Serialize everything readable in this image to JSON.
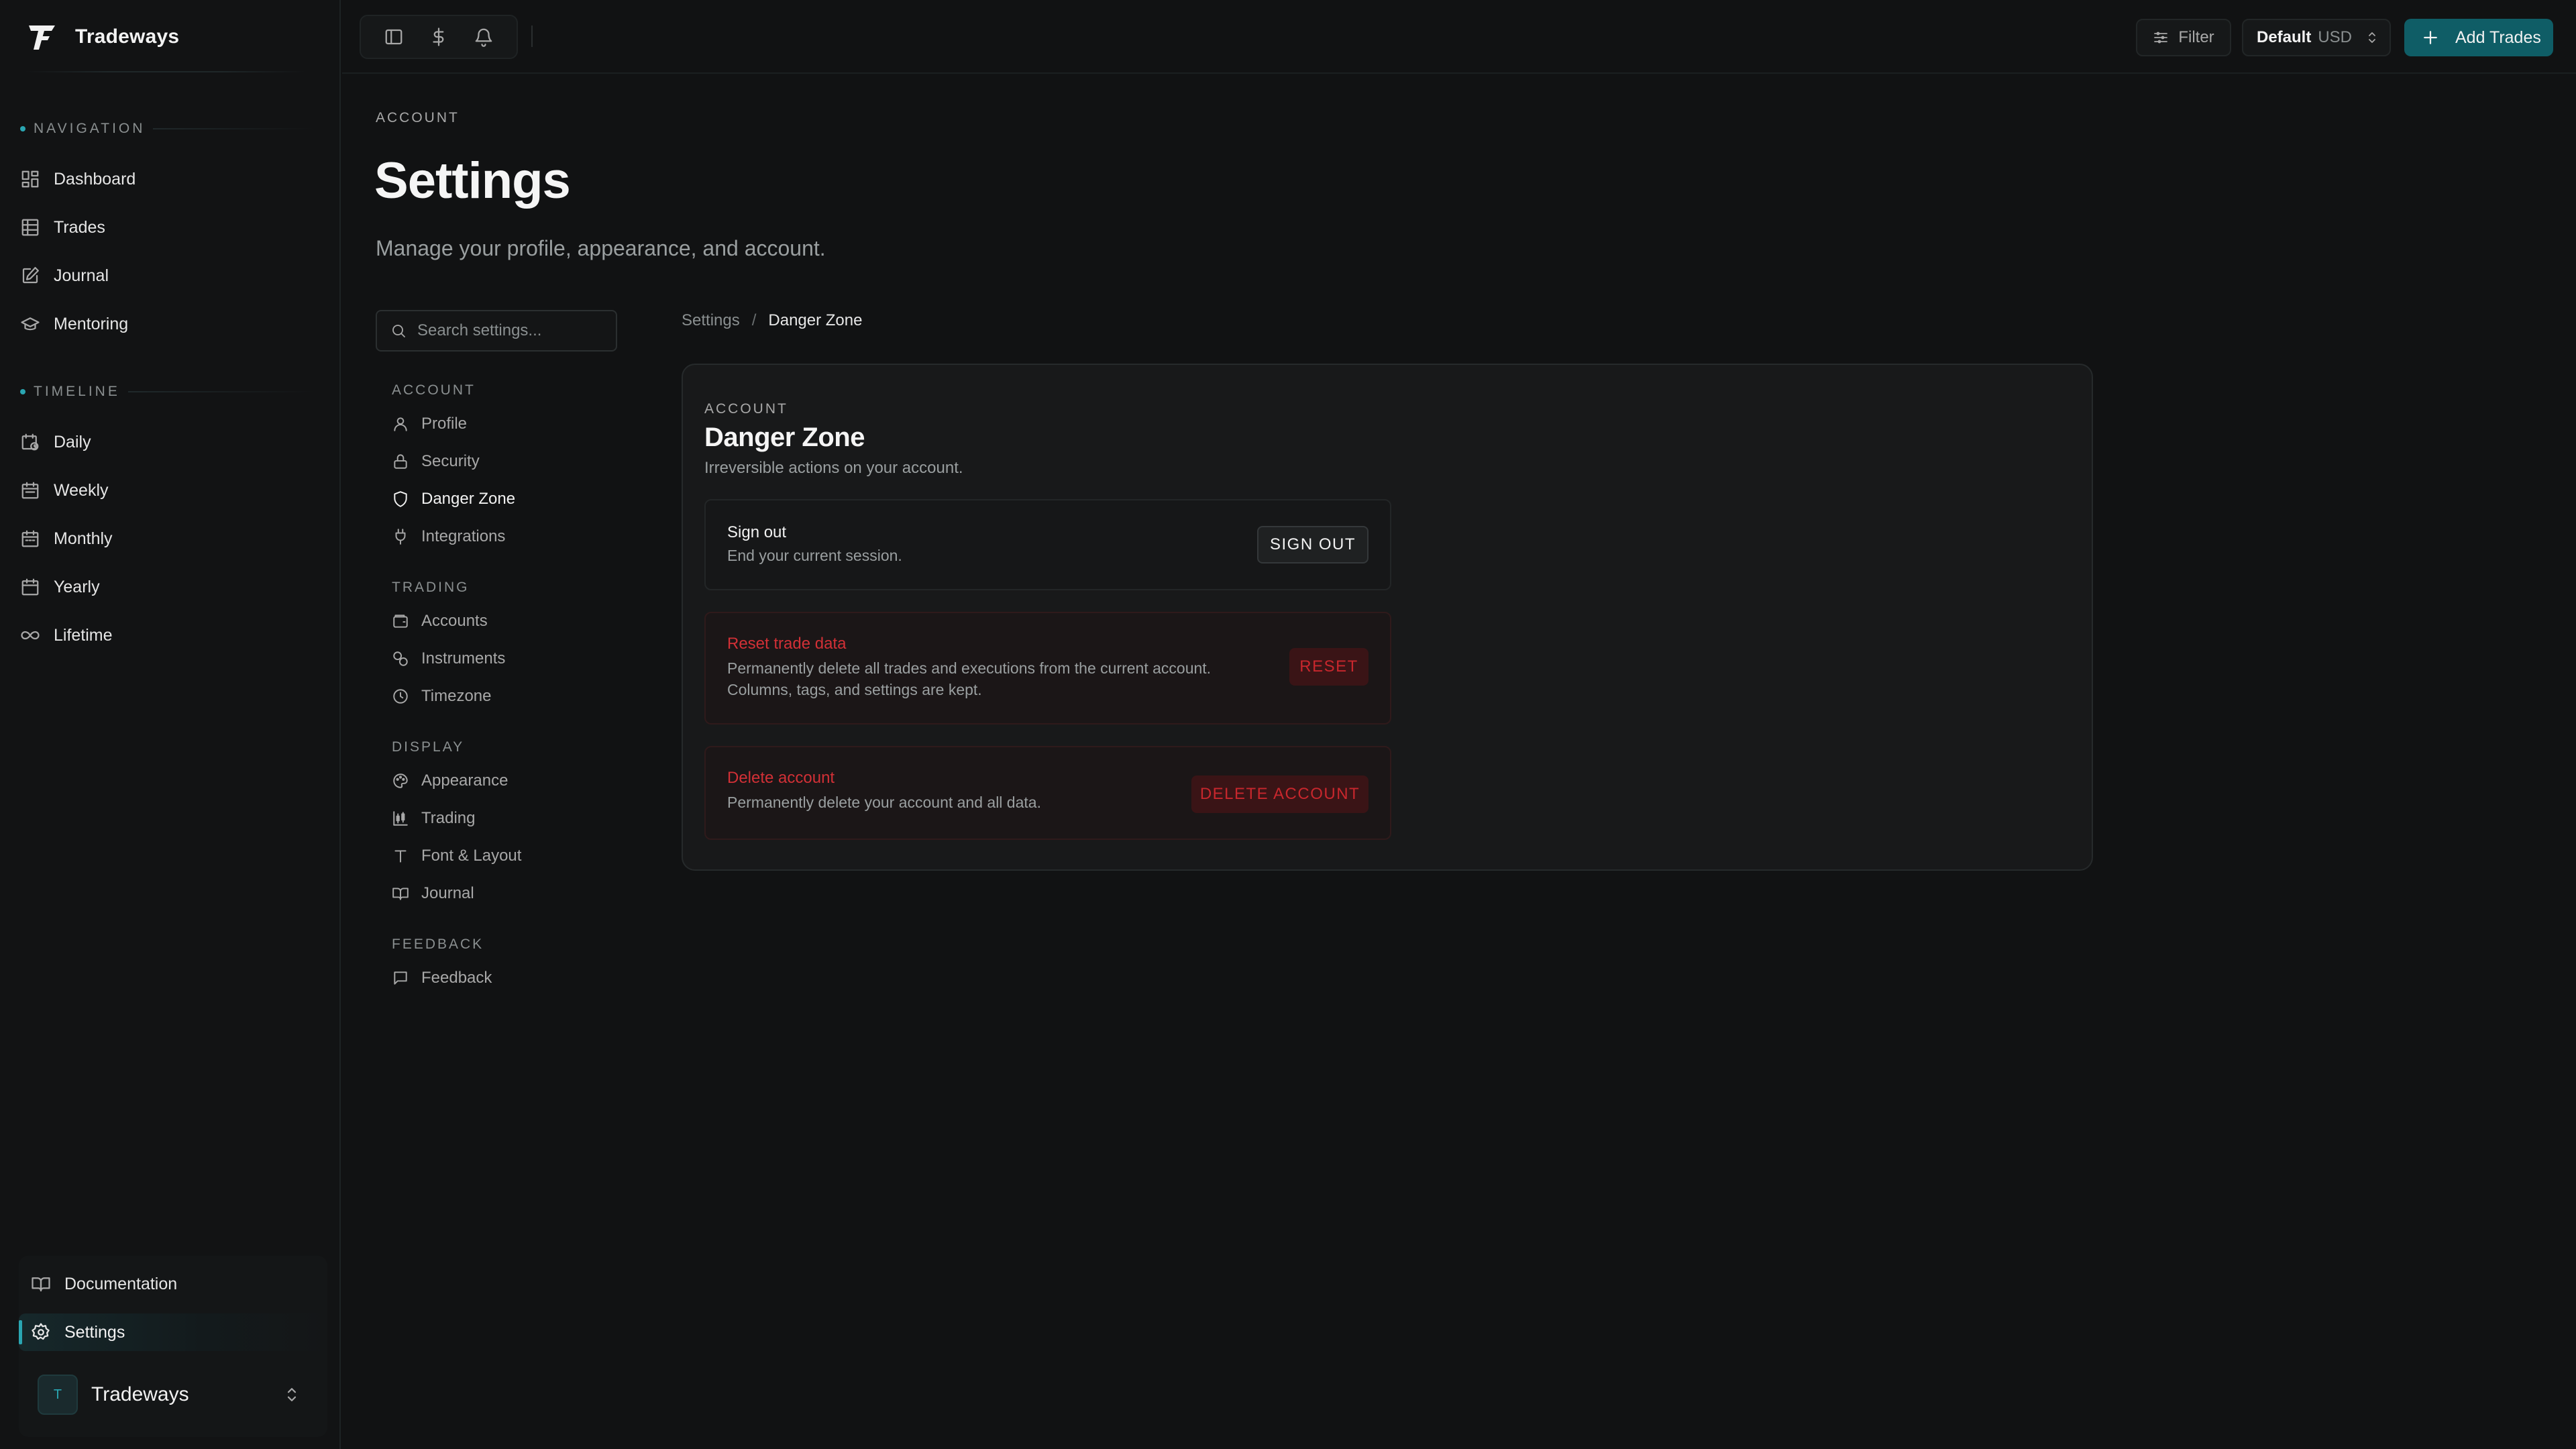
{
  "brand": {
    "name": "Tradeways"
  },
  "sidebar": {
    "navigation_label": "NAVIGATION",
    "nav_items": [
      {
        "label": "Dashboard",
        "icon": "dashboard-icon"
      },
      {
        "label": "Trades",
        "icon": "table-icon"
      },
      {
        "label": "Journal",
        "icon": "journal-edit-icon"
      },
      {
        "label": "Mentoring",
        "icon": "graduation-cap-icon"
      }
    ],
    "timeline_label": "TIMELINE",
    "timeline_items": [
      {
        "label": "Daily",
        "icon": "calendar-clock-icon"
      },
      {
        "label": "Weekly",
        "icon": "calendar-icon"
      },
      {
        "label": "Monthly",
        "icon": "calendar-icon"
      },
      {
        "label": "Yearly",
        "icon": "calendar-icon"
      },
      {
        "label": "Lifetime",
        "icon": "infinity-icon"
      }
    ],
    "bottom": {
      "documentation": "Documentation",
      "settings": "Settings",
      "workspace_initial": "T",
      "workspace_name": "Tradeways"
    }
  },
  "topbar": {
    "filter_label": "Filter",
    "account_name": "Default",
    "currency": "USD",
    "add_trades_label": "Add Trades"
  },
  "page": {
    "eyebrow": "ACCOUNT",
    "title": "Settings",
    "subtitle": "Manage your profile, appearance, and account."
  },
  "settings_nav": {
    "search_placeholder": "Search settings...",
    "groups": [
      {
        "heading": "ACCOUNT",
        "items": [
          "Profile",
          "Security",
          "Danger Zone",
          "Integrations"
        ]
      },
      {
        "heading": "TRADING",
        "items": [
          "Accounts",
          "Instruments",
          "Timezone"
        ]
      },
      {
        "heading": "DISPLAY",
        "items": [
          "Appearance",
          "Trading",
          "Font & Layout",
          "Journal"
        ]
      },
      {
        "heading": "FEEDBACK",
        "items": [
          "Feedback"
        ]
      }
    ],
    "active": "Danger Zone"
  },
  "breadcrumb": {
    "root": "Settings",
    "separator": "/",
    "current": "Danger Zone"
  },
  "panel": {
    "eyebrow": "ACCOUNT",
    "title": "Danger Zone",
    "subtitle": "Irreversible actions on your account.",
    "rows": [
      {
        "title": "Sign out",
        "description": "End your current session.",
        "button": "SIGN OUT"
      },
      {
        "title": "Reset trade data",
        "description_line1": "Permanently delete all trades and executions from the current account.",
        "description_line2": "Columns, tags, and settings are kept.",
        "button": "RESET"
      },
      {
        "title": "Delete account",
        "description": "Permanently delete your account and all data.",
        "button": "DELETE ACCOUNT"
      }
    ]
  },
  "colors": {
    "accent": "#2aa6b2",
    "primary_button": "#0f5d66",
    "danger": "#d23036",
    "background": "#111213"
  }
}
